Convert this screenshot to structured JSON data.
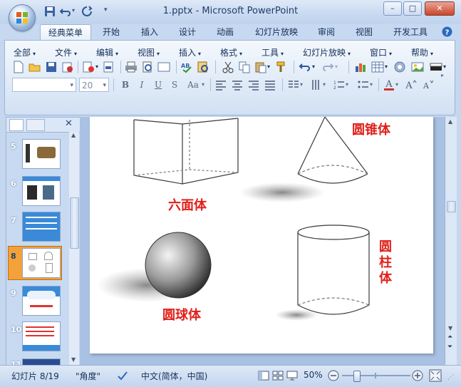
{
  "window": {
    "title": "1.pptx - Microsoft PowerPoint"
  },
  "tabs": [
    {
      "label": "经典菜单",
      "active": true
    },
    {
      "label": "开始"
    },
    {
      "label": "插入"
    },
    {
      "label": "设计"
    },
    {
      "label": "动画"
    },
    {
      "label": "幻灯片放映"
    },
    {
      "label": "审阅"
    },
    {
      "label": "视图"
    },
    {
      "label": "开发工具"
    }
  ],
  "menus": [
    "全部",
    "文件",
    "编辑",
    "视图",
    "插入",
    "格式",
    "工具",
    "幻灯片放映",
    "窗口",
    "帮助"
  ],
  "format": {
    "font_size_placeholder": "20",
    "bold": "B",
    "italic": "I",
    "underline": "U",
    "strike": "S",
    "case": "Aa"
  },
  "slides_panel": {
    "numbers": [
      "5",
      "6",
      "7",
      "8",
      "9",
      "10",
      "11"
    ],
    "selected": "8"
  },
  "slide": {
    "labels": {
      "cone": "圆锥体",
      "hexahedron": "六面体",
      "cylinder": "圆\n柱\n体",
      "sphere": "圆球体"
    }
  },
  "status": {
    "slide_info": "幻灯片 8/19",
    "theme": "\"角度\"",
    "language": "中文(简体，中国)",
    "zoom": "50%"
  },
  "colors": {
    "accent": "#2b5797",
    "label_red": "#e0201a",
    "selected_thumb": "#f2a13b"
  }
}
